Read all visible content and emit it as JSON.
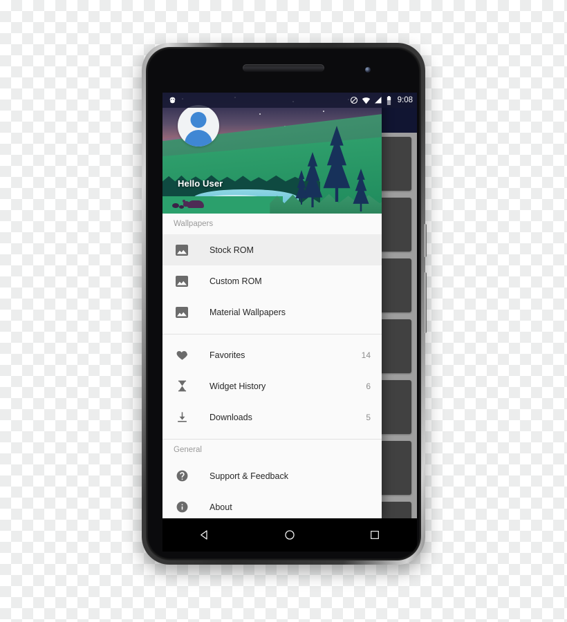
{
  "status_bar": {
    "logo_icon": "cyanogenmod-logo-icon",
    "icons": [
      "do-not-disturb-icon",
      "wifi-icon",
      "cell-signal-icon",
      "battery-icon"
    ],
    "time": "9:08"
  },
  "drawer": {
    "header": {
      "avatar_icon": "user-avatar-icon",
      "greeting": "Hello User",
      "illustration": "forest-sunset-landscape"
    },
    "sections": [
      {
        "label": "Wallpapers",
        "items": [
          {
            "icon": "image-icon",
            "label": "Stock ROM",
            "count": "",
            "selected": true
          },
          {
            "icon": "image-icon",
            "label": "Custom ROM",
            "count": "",
            "selected": false
          },
          {
            "icon": "image-icon",
            "label": "Material Wallpapers",
            "count": "",
            "selected": false
          }
        ]
      },
      {
        "label": "",
        "items": [
          {
            "icon": "heart-icon",
            "label": "Favorites",
            "count": "14",
            "selected": false
          },
          {
            "icon": "hourglass-icon",
            "label": "Widget History",
            "count": "6",
            "selected": false
          },
          {
            "icon": "download-icon",
            "label": "Downloads",
            "count": "5",
            "selected": false
          }
        ]
      },
      {
        "label": "General",
        "items": [
          {
            "icon": "help-circle-icon",
            "label": "Support & Feedback",
            "count": "",
            "selected": false
          },
          {
            "icon": "info-circle-icon",
            "label": "About",
            "count": "",
            "selected": false
          }
        ]
      }
    ]
  },
  "navigation_bar": {
    "back": "back-triangle-icon",
    "home": "home-circle-icon",
    "recents": "recents-square-icon"
  },
  "colors": {
    "toolbar": "#1c2351",
    "drawer_bg": "#fafafa",
    "selected_item": "#eeeeee",
    "icon_gray": "#6b6b6b",
    "accent_blue": "#3f87d4",
    "card_gray": "#6a6a6a"
  }
}
